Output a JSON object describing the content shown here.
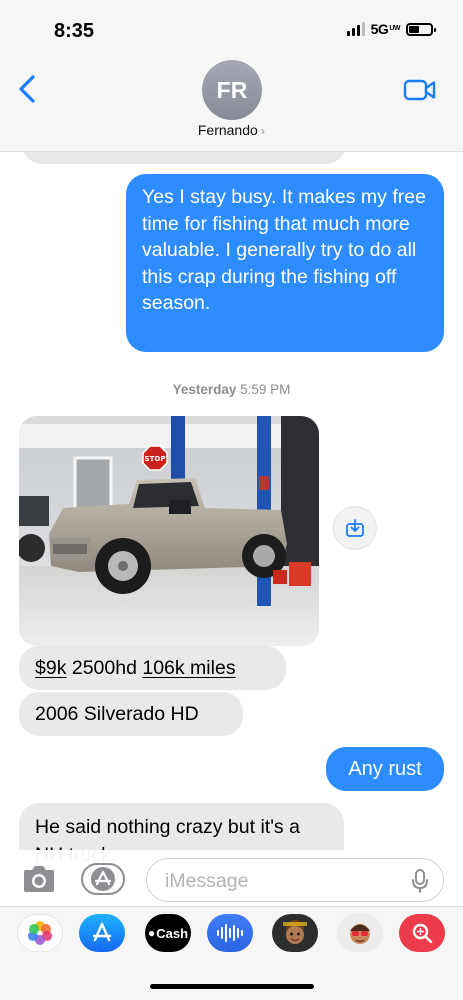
{
  "status_bar": {
    "time": "8:35",
    "network": "5G",
    "network_sub": "UW"
  },
  "header": {
    "avatar_initials": "FR",
    "contact_name": "Fernando",
    "chevron": "›"
  },
  "messages": {
    "msg1": "Yes I stay busy.  It makes my free time for fishing that much more valuable.  I generally try to do all this crap during the fishing off season.",
    "timestamp_day": "Yesterday",
    "timestamp_time": "5:59 PM",
    "photo_sign": "STOP",
    "price_amount": "$9k",
    "price_model": " 2500hd ",
    "price_miles": "106k miles",
    "model": "2006 Silverado HD",
    "rust": "Any rust",
    "said": "He said nothing crazy but it's a NH truck"
  },
  "input": {
    "placeholder": "iMessage"
  },
  "apps": {
    "cash_label": "Cash"
  },
  "colors": {
    "sent_bubble": "#2d8cff",
    "received_bubble": "#e9e9eb",
    "accent": "#1a7cff"
  }
}
